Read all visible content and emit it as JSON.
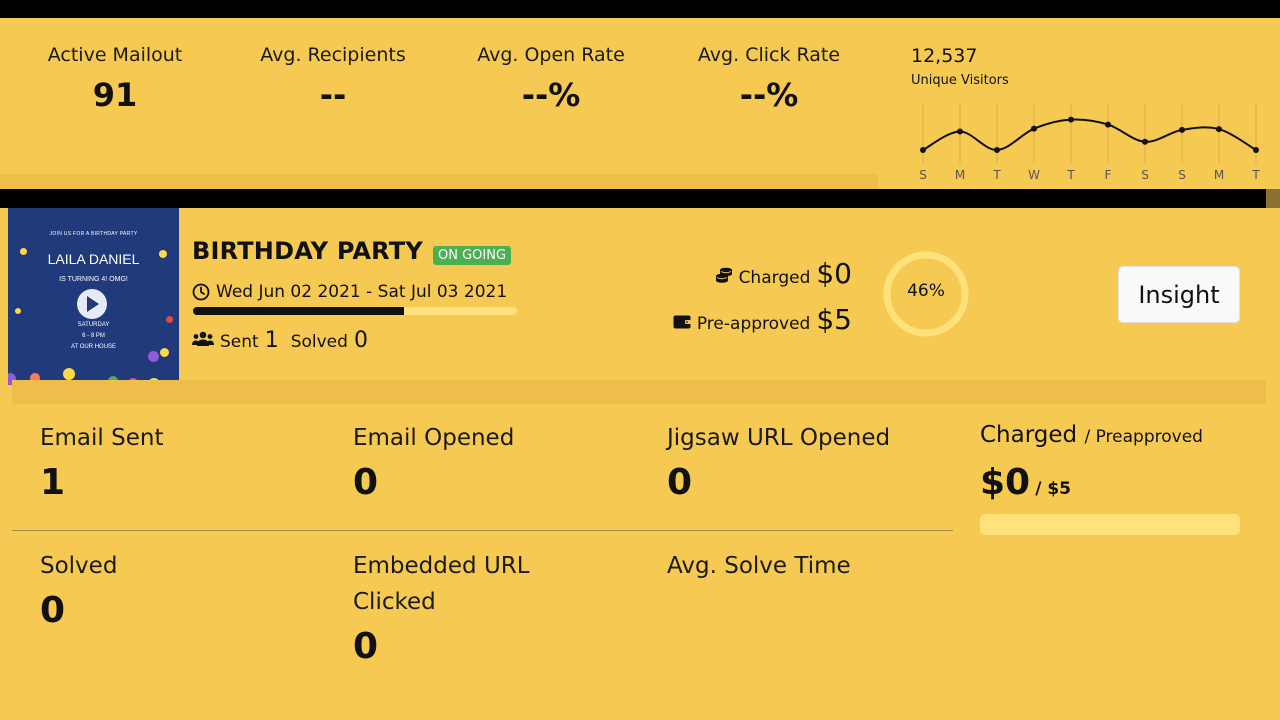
{
  "summary": {
    "active_mailout": {
      "label": "Active Mailout",
      "value": "91"
    },
    "avg_recipients": {
      "label": "Avg. Recipients",
      "value": "--"
    },
    "avg_open_rate": {
      "label": "Avg. Open Rate",
      "value": "--%"
    },
    "avg_click_rate": {
      "label": "Avg. Click Rate",
      "value": "--%"
    }
  },
  "visitors": {
    "count": "12,537",
    "label": "Unique Visitors",
    "days": [
      "S",
      "M",
      "T",
      "W",
      "T",
      "F",
      "S",
      "S",
      "M",
      "T"
    ],
    "relative_values": [
      0.0,
      0.45,
      0.0,
      0.52,
      0.74,
      0.62,
      0.2,
      0.49,
      0.51,
      0.0
    ]
  },
  "campaign": {
    "thumbnail": {
      "line1": "JOIN US FOR A BIRTHDAY PARTY",
      "name": "LAILA DANIEL",
      "line3": "IS TURNING 4! OMG!",
      "line4": "SATURDAY",
      "line5": "6 - 8 PM",
      "line6": "AT OUR HOUSE"
    },
    "title": "BIRTHDAY PARTY",
    "status": "ON GOING",
    "date_range": "Wed Jun 02 2021 - Sat Jul 03 2021",
    "date_progress": 0.65,
    "sent_label": "Sent",
    "sent_value": "1",
    "solved_label": "Solved",
    "solved_value": "0",
    "charged_label": "Charged",
    "charged_value": "$0",
    "preapproved_label": "Pre-approved",
    "preapproved_value": "$5",
    "ring_percent": 46,
    "ring_text": "46%",
    "insight_label": "Insight"
  },
  "metrics": {
    "email_sent": {
      "label": "Email Sent",
      "value": "1"
    },
    "email_opened": {
      "label": "Email Opened",
      "value": "0"
    },
    "jigsaw_url_opened": {
      "label": "Jigsaw URL Opened",
      "value": "0"
    },
    "solved": {
      "label": "Solved",
      "value": "0"
    },
    "embedded_url_clicked": {
      "label": "Embedded URL Clicked",
      "value": "0"
    },
    "avg_solve_time": {
      "label": "Avg. Solve Time",
      "value": ""
    }
  },
  "charged_panel": {
    "title": "Charged",
    "subtitle": "/ Preapproved",
    "value": "$0",
    "of_value": "/ $5",
    "fraction": 0.0
  },
  "colors": {
    "background": "#f6ca52",
    "strip": "#edbf4a",
    "light_bar": "#ffe27c",
    "badge_green": "#4caf50",
    "thumb_bg": "#213a7c"
  }
}
